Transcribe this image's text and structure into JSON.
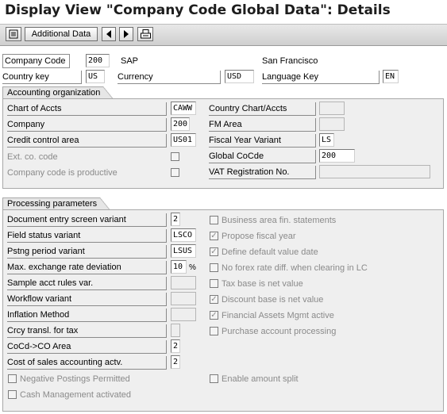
{
  "title": "Display View \"Company Code Global Data\": Details",
  "toolbar": {
    "additional_data": "Additional Data"
  },
  "header": {
    "company_code_label": "Company Code",
    "company_code_value": "200",
    "company_name": "SAP",
    "city": "San Francisco",
    "country_key_label": "Country key",
    "country_key_value": "US",
    "currency_label": "Currency",
    "currency_value": "USD",
    "language_key_label": "Language Key",
    "language_key_value": "EN"
  },
  "accounting": {
    "title": "Accounting organization",
    "chart_of_accts_label": "Chart of Accts",
    "chart_of_accts_value": "CAWW",
    "company_label": "Company",
    "company_value": "200",
    "credit_control_label": "Credit control area",
    "credit_control_value": "US01",
    "ext_co_code_label": "Ext. co. code",
    "company_productive_label": "Company code is productive",
    "country_chart_label": "Country Chart/Accts",
    "fm_area_label": "FM Area",
    "fiscal_year_variant_label": "Fiscal Year Variant",
    "fiscal_year_variant_value": "LS",
    "global_cocde_label": "Global CoCde",
    "global_cocde_value": "200",
    "vat_reg_label": "VAT Registration No."
  },
  "processing": {
    "title": "Processing parameters",
    "doc_entry_label": "Document entry screen variant",
    "doc_entry_value": "2",
    "field_status_label": "Field status variant",
    "field_status_value": "LSCO",
    "pstng_period_label": "Pstng period variant",
    "pstng_period_value": "LSUS",
    "max_exchange_label": "Max. exchange rate deviation",
    "max_exchange_value": "10",
    "max_exchange_unit": "%",
    "sample_acct_label": "Sample acct rules var.",
    "workflow_label": "Workflow variant",
    "inflation_label": "Inflation Method",
    "crcy_transl_label": "Crcy transl. for tax",
    "cocd_co_label": "CoCd->CO Area",
    "cocd_co_value": "2",
    "cost_of_sales_label": "Cost of sales accounting actv.",
    "cost_of_sales_value": "2",
    "negative_postings_label": "Negative Postings Permitted",
    "cash_mgmt_label": "Cash Management activated",
    "business_area_label": "Business area fin. statements",
    "propose_fiscal_label": "Propose fiscal year",
    "define_default_label": "Define default value date",
    "no_forex_label": "No forex rate diff. when clearing in LC",
    "tax_base_label": "Tax base is net value",
    "discount_base_label": "Discount base is net value",
    "financial_assets_label": "Financial Assets Mgmt active",
    "purchase_account_label": "Purchase account processing",
    "enable_amount_split_label": "Enable amount split"
  }
}
